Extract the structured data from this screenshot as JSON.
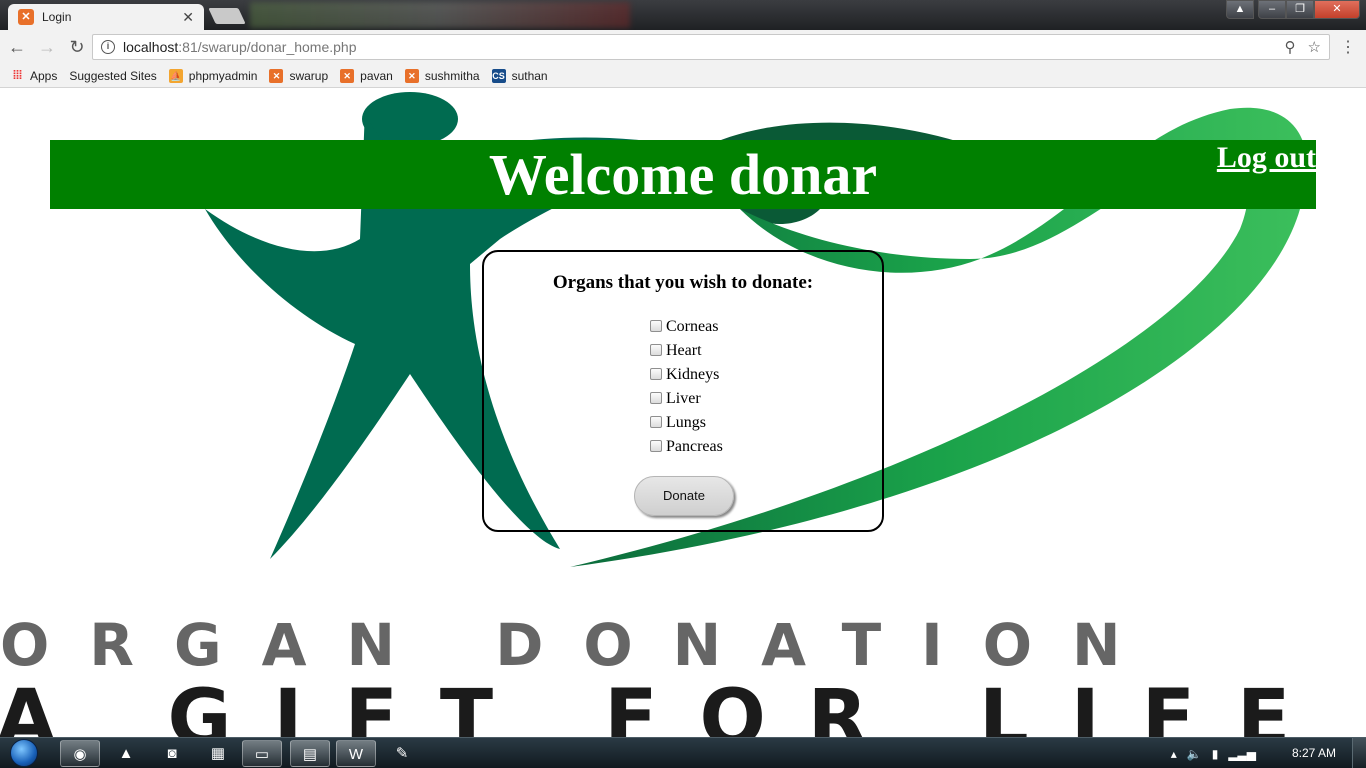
{
  "browser": {
    "tab_title": "Login",
    "url_host": "localhost",
    "url_rest": ":81/swarup/donar_home.php",
    "bookmarks": [
      {
        "label": "Apps",
        "icon": "apps-grid-icon"
      },
      {
        "label": "Suggested Sites",
        "icon": "page-icon"
      },
      {
        "label": "phpmyadmin",
        "icon": "phpmyadmin-icon"
      },
      {
        "label": "swarup",
        "icon": "xampp-icon"
      },
      {
        "label": "pavan",
        "icon": "xampp-icon"
      },
      {
        "label": "sushmitha",
        "icon": "xampp-icon"
      },
      {
        "label": "suthan",
        "icon": "cs-icon"
      }
    ]
  },
  "page": {
    "heading": "Welcome donar",
    "logout_label": "Log out",
    "form_title": "Organs that you wish to donate:",
    "organs": [
      "Corneas",
      "Heart",
      "Kidneys",
      "Liver",
      "Lungs",
      "Pancreas"
    ],
    "donate_label": "Donate",
    "banner_line1": "ORGAN DONATION",
    "banner_line2": "A GIFT FOR LIFE"
  },
  "taskbar": {
    "clock": "8:27 AM"
  },
  "colors": {
    "header_green": "#008000",
    "logo_dark_green": "#006b45",
    "logo_light_green": "#2fb34a"
  }
}
